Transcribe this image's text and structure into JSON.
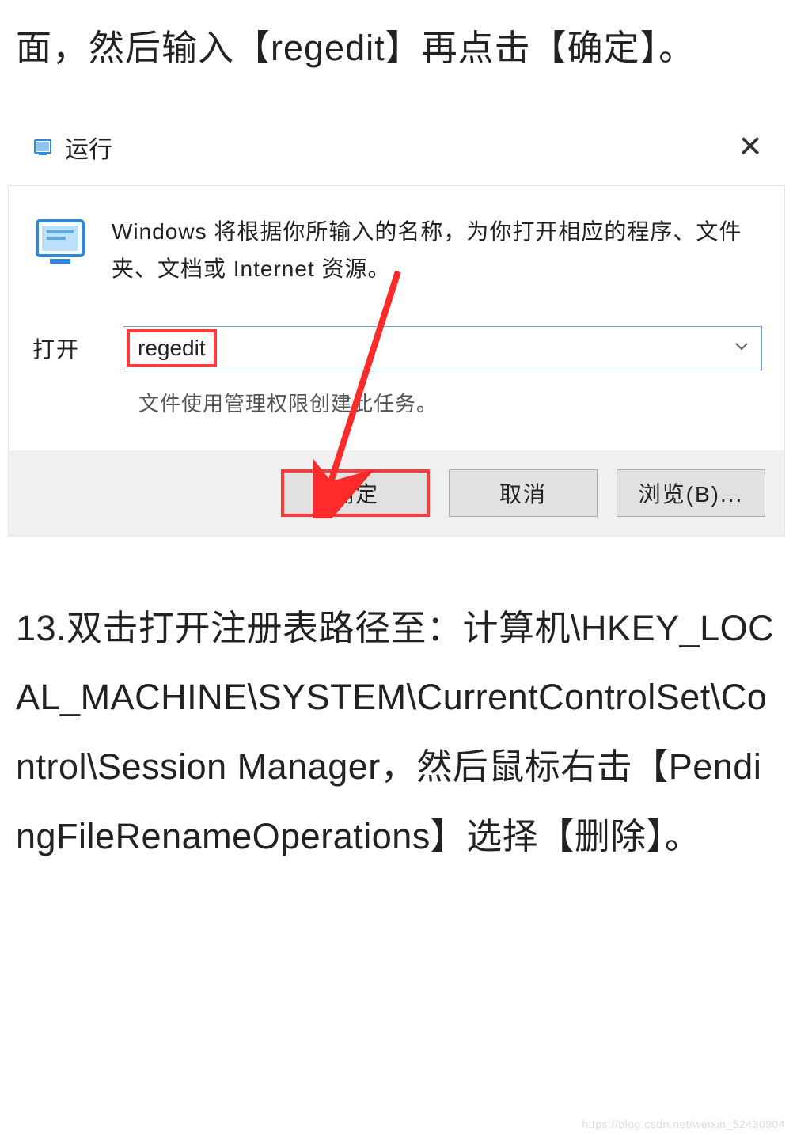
{
  "article": {
    "top_text": "面，然后输入【regedit】再点击【确定】。",
    "bottom_text": "13.双击打开注册表路径至：计算机\\HKEY_LOCAL_MACHINE\\SYSTEM\\CurrentControlSet\\Control\\Session Manager，然后鼠标右击【PendingFileRenameOperations】选择【删除】。"
  },
  "run_dialog": {
    "title": "运行",
    "close_icon": "close-icon",
    "description": "Windows 将根据你所输入的名称，为你打开相应的程序、文件夹、文档或 Internet 资源。",
    "open_label": "打开",
    "input_value": "regedit",
    "admin_note": "文件使用管理权限创建此任务。",
    "buttons": {
      "ok": "确定",
      "cancel": "取消",
      "browse": "浏览(B)..."
    }
  },
  "watermark": "https://blog.csdn.net/weixin_52430904"
}
